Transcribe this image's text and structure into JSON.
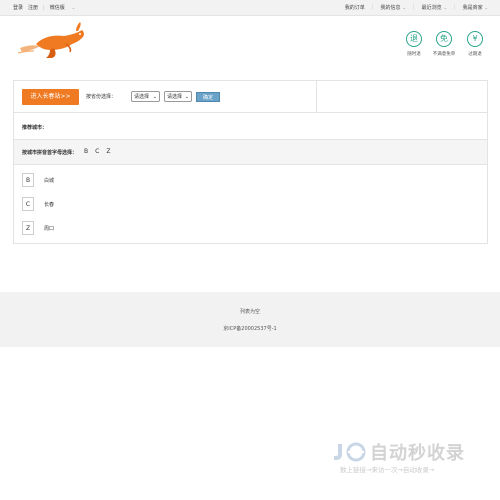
{
  "topbar": {
    "login": "登录",
    "register": "注册",
    "wechat": "微信版",
    "right_links": [
      "我的订单",
      "我的信息",
      "最近浏览",
      "我是商家"
    ]
  },
  "badges": [
    {
      "glyph": "退",
      "label": "随时退"
    },
    {
      "glyph": "免",
      "label": "不满意免单"
    },
    {
      "glyph": "¥",
      "label": "过期退"
    }
  ],
  "province_row": {
    "enter_label": "进入长春站>>",
    "province_label": "按省份选择：",
    "select1_value": "请选择",
    "select2_value": "请选择",
    "confirm_label": "确定"
  },
  "recommend_label": "推荐城市：",
  "pinyin_row": {
    "label": "按城市拼音首字母选择：",
    "letters": [
      "B",
      "C",
      "Z"
    ]
  },
  "cities": [
    {
      "letter": "B",
      "name": "白城"
    },
    {
      "letter": "C",
      "name": "长春"
    },
    {
      "letter": "Z",
      "name": "周口"
    }
  ],
  "footer": {
    "line1": "列表为空",
    "line2": "京ICP备20002537号-1"
  },
  "watermark": {
    "big": "自动秒收录",
    "small": "数上链接→来访一次→自动收录→"
  },
  "colors": {
    "accent_orange": "#ef7a22",
    "badge_green": "#2aa58a",
    "confirm_blue": "#6aa2c9"
  }
}
